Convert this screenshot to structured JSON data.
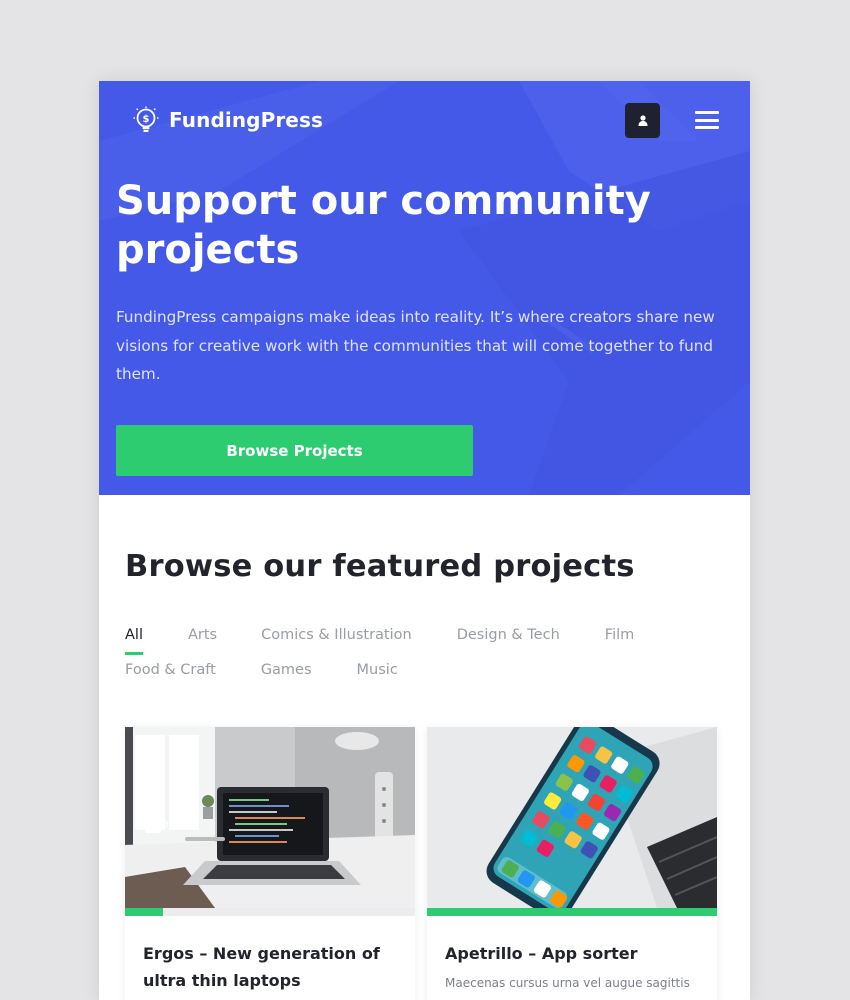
{
  "header": {
    "brand": "FundingPress",
    "logo_icon": "lightbulb-dollar-icon",
    "user_icon": "user-icon",
    "menu_icon": "hamburger-menu-icon"
  },
  "hero": {
    "title": "Support our community projects",
    "text": "FundingPress campaigns make ideas into reality. It’s where creators share new visions for creative work with the communities that will come together to fund them.",
    "cta_label": "Browse Projects"
  },
  "featured": {
    "title": "Browse our featured projects",
    "filters": [
      "All",
      "Arts",
      "Comics & Illustration",
      "Design & Tech",
      "Film",
      "Food & Craft",
      "Games",
      "Music"
    ],
    "active_filter": "All"
  },
  "projects": [
    {
      "title": "Ergos – New generation of ultra thin laptops",
      "description": "",
      "progress": 0.13,
      "image": "laptop-on-desk-photo"
    },
    {
      "title": "Apetrillo – App sorter",
      "description": "Maecenas cursus urna vel augue sagittis",
      "progress": 1.0,
      "image": "smartphone-on-laptop-photo"
    }
  ],
  "colors": {
    "hero_bg": "#4559e8",
    "accent_green": "#2ecc71",
    "heading_dark": "#22232b",
    "muted_text": "#9a9ca4"
  }
}
